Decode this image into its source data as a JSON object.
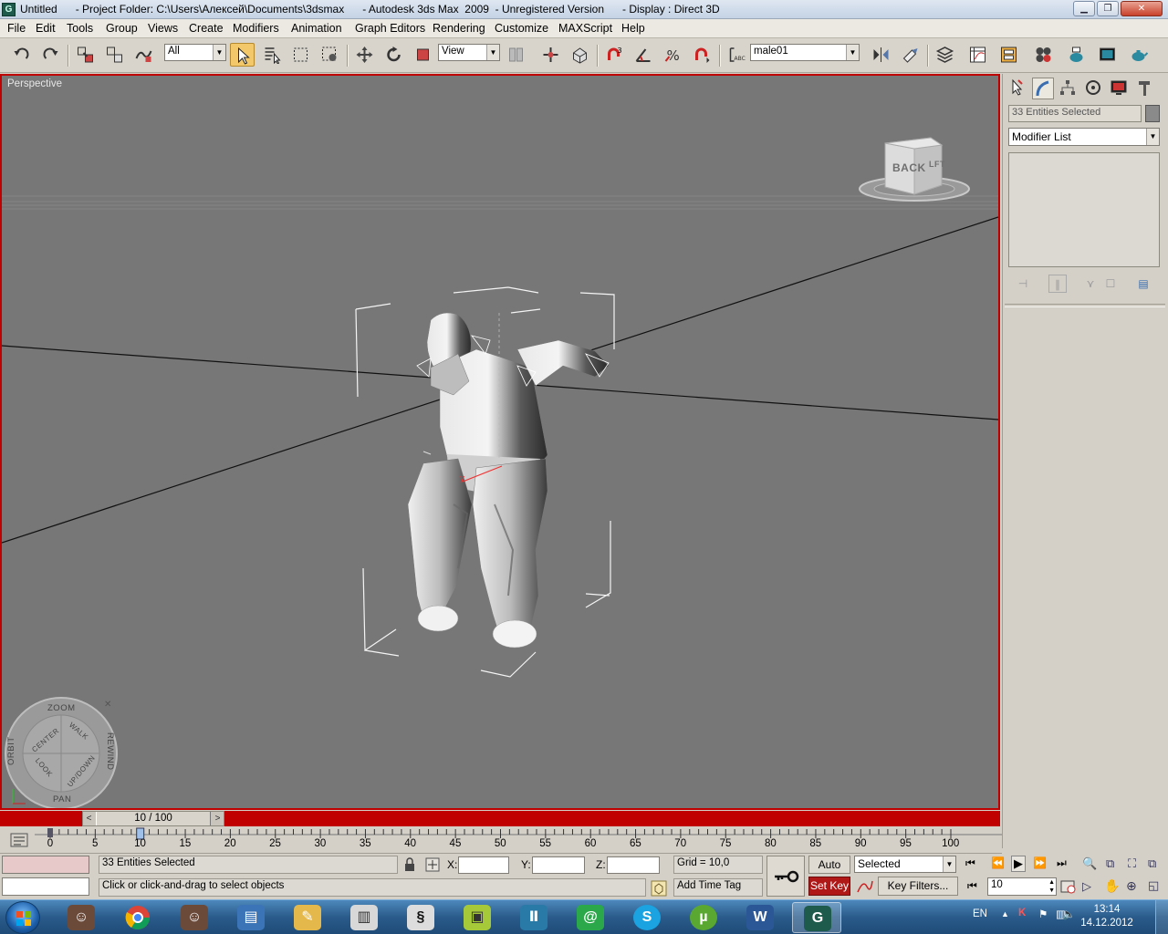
{
  "window": {
    "title": "Untitled      - Project Folder: C:\\Users\\Алексей\\Documents\\3dsmax      - Autodesk 3ds Max  2009  - Unregistered Version      - Display : Direct 3D",
    "minimize_glyph": "▁",
    "maximize_glyph": "❐",
    "close_glyph": "✕"
  },
  "menu": [
    "File",
    "Edit",
    "Tools",
    "Group",
    "Views",
    "Create",
    "Modifiers",
    "Animation",
    "Graph Editors",
    "Rendering",
    "Customize",
    "MAXScript",
    "Help"
  ],
  "toolbar": {
    "selection_filter": "All",
    "ref_coord": "View",
    "named_selection": "male01"
  },
  "viewport": {
    "label": "Perspective",
    "viewcube_face": "BACK",
    "viewcube_side": "LFT",
    "wheel": {
      "zoom": "ZOOM",
      "orbit": "ORBIT",
      "rewind": "REWIND",
      "pan": "PAN",
      "center": "CENTER",
      "walk": "WALK",
      "look": "LOOK",
      "updown": "UP/DOWN",
      "close": "✕"
    }
  },
  "command_panel": {
    "object_name": "33 Entities Selected",
    "modifier_list": "Modifier List"
  },
  "time_slider": {
    "label": "10 / 100",
    "prev": "<",
    "next": ">",
    "current_frame": 10,
    "total_frames": 100
  },
  "trackbar": {
    "ticks": [
      "0",
      "5",
      "10",
      "15",
      "20",
      "25",
      "30",
      "35",
      "40",
      "45",
      "50",
      "55",
      "60",
      "65",
      "70",
      "75",
      "80",
      "85",
      "90",
      "95",
      "100"
    ]
  },
  "status": {
    "selection": "33 Entities Selected",
    "prompt": "Click or click-and-drag to select objects",
    "x_label": "X:",
    "y_label": "Y:",
    "z_label": "Z:",
    "grid": "Grid = 10,0",
    "add_time_tag": "Add Time Tag",
    "auto_key": "Auto Key",
    "set_key": "Set Key",
    "key_mode": "Selected",
    "key_filters": "Key Filters...",
    "frame": "10"
  },
  "taskbar": {
    "language": "EN",
    "time": "13:14",
    "date": "14.12.2012"
  },
  "colors": {
    "active_viewport_border": "#c00000",
    "viewport_bg": "#777777",
    "taskbar": "#2a5b8a",
    "set_key": "#b01818"
  }
}
